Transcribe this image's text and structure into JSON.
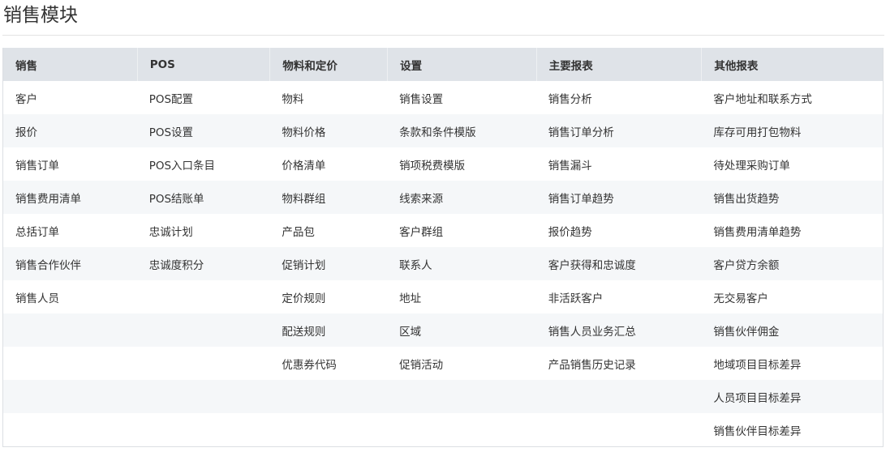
{
  "page": {
    "title": "销售模块"
  },
  "table": {
    "headers": [
      "销售",
      "POS",
      "物料和定价",
      "设置",
      "主要报表",
      "其他报表"
    ],
    "rows": [
      [
        "客户",
        "POS配置",
        "物料",
        "销售设置",
        "销售分析",
        "客户地址和联系方式"
      ],
      [
        "报价",
        "POS设置",
        "物料价格",
        "条款和条件模版",
        "销售订单分析",
        "库存可用打包物料"
      ],
      [
        "销售订单",
        "POS入口条目",
        "价格清单",
        "销项税费模版",
        "销售漏斗",
        "待处理采购订单"
      ],
      [
        "销售费用清单",
        "POS结账单",
        "物料群组",
        "线索来源",
        "销售订单趋势",
        "销售出货趋势"
      ],
      [
        "总括订单",
        "忠诚计划",
        "产品包",
        "客户群组",
        "报价趋势",
        "销售费用清单趋势"
      ],
      [
        "销售合作伙伴",
        "忠诚度积分",
        "促销计划",
        "联系人",
        "客户获得和忠诚度",
        "客户贷方余额"
      ],
      [
        "销售人员",
        "",
        "定价规则",
        "地址",
        "非活跃客户",
        "无交易客户"
      ],
      [
        "",
        "",
        "配送规则",
        "区域",
        "销售人员业务汇总",
        "销售伙伴佣金"
      ],
      [
        "",
        "",
        "优惠券代码",
        "促销活动",
        "产品销售历史记录",
        "地域项目目标差异"
      ],
      [
        "",
        "",
        "",
        "",
        "",
        "人员项目目标差异"
      ],
      [
        "",
        "",
        "",
        "",
        "",
        "销售伙伴目标差异"
      ]
    ]
  }
}
